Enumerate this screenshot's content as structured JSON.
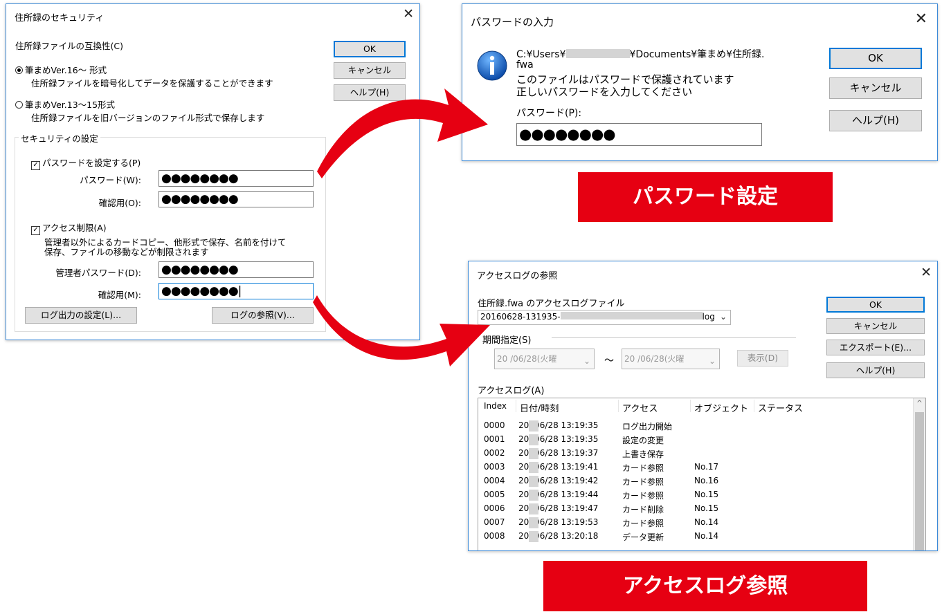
{
  "security_dialog": {
    "title": "住所録のセキュリティ",
    "compat_label": "住所録ファイルの互換性(C)",
    "option1_label": "筆まめVer.16〜  形式",
    "option1_desc": "住所録ファイルを暗号化してデータを保護することができます",
    "option2_label": "筆まめVer.13〜15形式",
    "option2_desc": "住所録ファイルを旧バージョンのファイル形式で保存します",
    "ok_label": "OK",
    "cancel_label": "キャンセル",
    "help_label": "ヘルプ(H)",
    "security_group_label": "セキュリティの設定",
    "set_password_label": "パスワードを設定する(P)",
    "password_label": "パスワード(W):",
    "password_value": "●●●●●●●●",
    "confirm_label": "確認用(O):",
    "confirm_value": "●●●●●●●●",
    "access_limit_label": "アクセス制限(A)",
    "access_desc_1": "管理者以外によるカードコピー、他形式で保存、名前を付けて",
    "access_desc_2": "保存、ファイルの移動などが制限されます",
    "admin_password_label": "管理者パスワード(D):",
    "admin_password_value": "●●●●●●●●",
    "admin_confirm_label": "確認用(M):",
    "admin_confirm_value": "●●●●●●●●|",
    "log_settings_label": "ログ出力の設定(L)...",
    "log_view_label": "ログの参照(V)..."
  },
  "password_dialog": {
    "title": "パスワードの入力",
    "path_prefix": "C:¥Users¥",
    "path_suffix": "¥Documents¥筆まめ¥住所録.",
    "path_line2": "fwa",
    "message_1": "このファイルはパスワードで保護されています",
    "message_2": "正しいパスワードを入力してください",
    "password_label": "パスワード(P):",
    "password_value": "●●●●●●●●",
    "ok_label": "OK",
    "cancel_label": "キャンセル",
    "help_label": "ヘルプ(H)"
  },
  "banner_password": "パスワード設定",
  "access_log_dialog": {
    "title": "アクセスログの参照",
    "file_label": "住所録.fwa のアクセスログファイル",
    "file_value_prefix": "20160628-131935-",
    "file_value_suffix": "log",
    "period_label": "期間指定(S)",
    "date_from": "20  /06/28(火曜",
    "date_to": "20  /06/28(火曜",
    "tilde": "〜",
    "show_label": "表示(D)",
    "ok_label": "OK",
    "cancel_label": "キャンセル",
    "export_label": "エクスポート(E)...",
    "help_label": "ヘルプ(H)",
    "log_label": "アクセスログ(A)",
    "columns": [
      "Index",
      "日付/時刻",
      "アクセス",
      "オブジェクト",
      "ステータス"
    ],
    "rows": [
      {
        "index": "0000",
        "datetime": "20  /06/28 13:19:35",
        "access": "ログ出力開始",
        "object": ""
      },
      {
        "index": "0001",
        "datetime": "20  /06/28 13:19:35",
        "access": "設定の変更",
        "object": ""
      },
      {
        "index": "0002",
        "datetime": "20  /06/28 13:19:37",
        "access": "上書き保存",
        "object": ""
      },
      {
        "index": "0003",
        "datetime": "20  /06/28 13:19:41",
        "access": "カード参照",
        "object": "No.17"
      },
      {
        "index": "0004",
        "datetime": "20  /06/28 13:19:42",
        "access": "カード参照",
        "object": "No.16"
      },
      {
        "index": "0005",
        "datetime": "20  /06/28 13:19:44",
        "access": "カード参照",
        "object": "No.15"
      },
      {
        "index": "0006",
        "datetime": "20  /06/28 13:19:47",
        "access": "カード削除",
        "object": "No.15"
      },
      {
        "index": "0007",
        "datetime": "20  /06/28 13:19:53",
        "access": "カード参照",
        "object": "No.14"
      },
      {
        "index": "0008",
        "datetime": "20  /06/28 13:20:18",
        "access": "データ更新",
        "object": "No.14"
      }
    ]
  },
  "banner_access_log": "アクセスログ参照",
  "colors": {
    "accent_red": "#e60012",
    "focus_blue": "#0078d7"
  }
}
